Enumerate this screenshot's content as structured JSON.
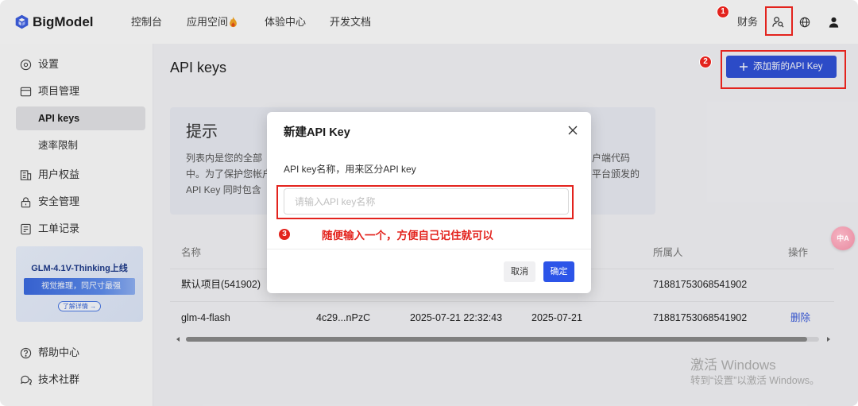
{
  "header": {
    "logo_text": "BigModel",
    "logo_icon": "bigmodel-logo-icon",
    "nav": [
      {
        "label": "控制台"
      },
      {
        "label": "应用空间",
        "icon": "fire-icon"
      },
      {
        "label": "体验中心"
      },
      {
        "label": "开发文档"
      }
    ],
    "finance_label": "财务",
    "icons": [
      "user-search-icon",
      "globe-icon",
      "user-icon"
    ]
  },
  "sidebar": {
    "items": [
      {
        "label": "设置",
        "icon": "settings-icon"
      },
      {
        "label": "项目管理",
        "icon": "project-icon"
      },
      {
        "label": "API keys",
        "selected": true
      },
      {
        "label": "速率限制"
      },
      {
        "label": "用户权益",
        "icon": "benefits-icon"
      },
      {
        "label": "安全管理",
        "icon": "lock-icon"
      },
      {
        "label": "工单记录",
        "icon": "ticket-icon"
      }
    ],
    "banner": {
      "title": "GLM-4.1V-Thinking上线",
      "subtitle": "视觉推理，同尺寸最强",
      "cta": "了解详情 →"
    },
    "bottom_items": [
      {
        "label": "帮助中心",
        "icon": "help-icon"
      },
      {
        "label": "技术社群",
        "icon": "chat-icon"
      }
    ]
  },
  "main": {
    "title": "API keys",
    "add_button": "添加新的API Key",
    "add_button_icon": "plus-icon",
    "tip": {
      "title": "提示",
      "lines_left": [
        "列表内是您的全部",
        "中。为了保护您帐户",
        "API Key 同时包含"
      ],
      "lines_right": [
        "户端代码",
        "平台颁发的"
      ]
    },
    "table": {
      "headers": {
        "name": "名称",
        "owner": "所属人",
        "action": "操作"
      },
      "rows": [
        {
          "name": "默认项目(541902)",
          "owner": "71881753068541902"
        },
        {
          "name": "glm-4-flash",
          "key": "4c29...nPzC",
          "created": "2025-07-21 22:32:43",
          "last_used": "2025-07-21",
          "owner": "71881753068541902",
          "action": "删除"
        }
      ]
    }
  },
  "modal": {
    "title": "新建API Key",
    "field_label": "API key名称，用来区分API key",
    "input_placeholder": "请输入API key名称",
    "input_value": "",
    "cancel": "取消",
    "confirm": "确定"
  },
  "annotations": {
    "steps": [
      "1",
      "2",
      "3"
    ],
    "note": "随便输入一个，方便自己记住就可以"
  },
  "translate_badge": {
    "text": "中A",
    "icon": "translate-icon"
  },
  "watermark": {
    "line1": "激活 Windows",
    "line2": "转到“设置”以激活 Windows。"
  },
  "colors": {
    "brand_blue": "#3052d8",
    "confirm_blue": "#2c54e8",
    "link_blue": "#3a5bdc",
    "annotation_red": "#e3231d"
  }
}
